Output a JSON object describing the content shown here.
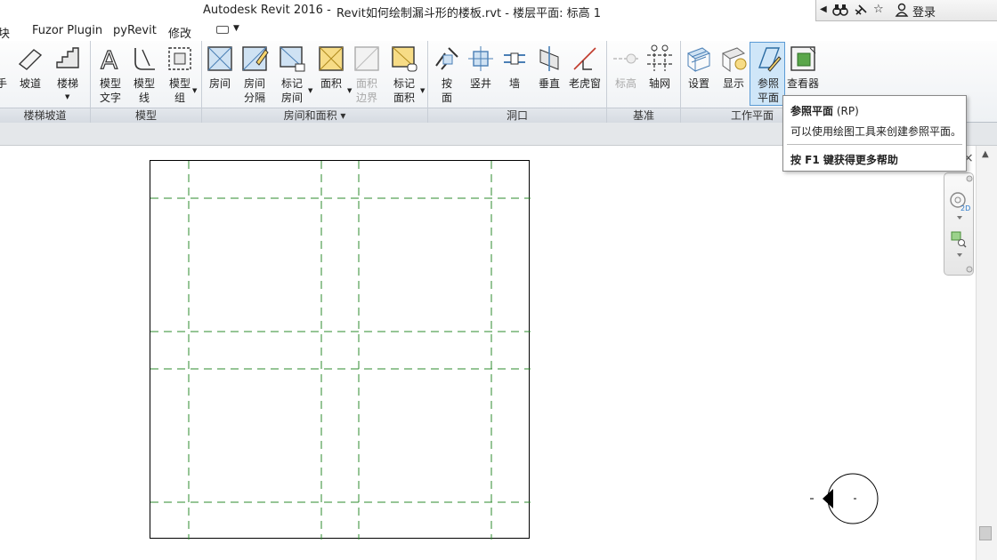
{
  "window": {
    "app_title": "Autodesk Revit 2016 -",
    "document_title": "Revit如何绘制漏斗形的楼板.rvt - 楼层平面: 标高 1",
    "login_label": "登录"
  },
  "menu_tabs": [
    "块",
    "Fuzor Plugin",
    "pyRevit",
    "修改"
  ],
  "ribbon": {
    "panels": [
      {
        "title": "楼梯坡道"
      },
      {
        "title": "模型"
      },
      {
        "title": "房间和面积 ▾"
      },
      {
        "title": "洞口"
      },
      {
        "title": "基准"
      },
      {
        "title": "工作平面"
      }
    ],
    "buttons": {
      "stair_partial": "手",
      "ramp": "坡道",
      "stair": "楼梯",
      "model_text": "模型\n文字",
      "model_line": "模型\n线",
      "model_group": "模型\n组",
      "room": "房间",
      "room_separator": "房间\n分隔",
      "tag_room": "标记\n房间",
      "area": "面积",
      "area_boundary": "面积\n边界",
      "tag_area": "标记\n面积",
      "by_face": "按\n面",
      "shaft": "竖井",
      "wall_opening": "墙",
      "vertical": "垂直",
      "dormer": "老虎窗",
      "level": "标高",
      "grid": "轴网",
      "set": "设置",
      "show": "显示",
      "ref_plane": "参照\n平面",
      "viewer": "查看器"
    }
  },
  "tooltip": {
    "title": "参照平面",
    "shortcut": "(RP)",
    "description": "可以使用绘图工具来创建参照平面。",
    "help": "按 F1 键获得更多帮助"
  },
  "colors": {
    "ref_plane_line": "#2e8b2e",
    "ribbon_active": "#cfe6f8",
    "ribbon_bg": "#eef1f4"
  },
  "icons": [
    "binoculars-icon",
    "satellite-icon",
    "star-icon",
    "user-icon",
    "navigation-wheel-icon",
    "zoom-icon"
  ]
}
